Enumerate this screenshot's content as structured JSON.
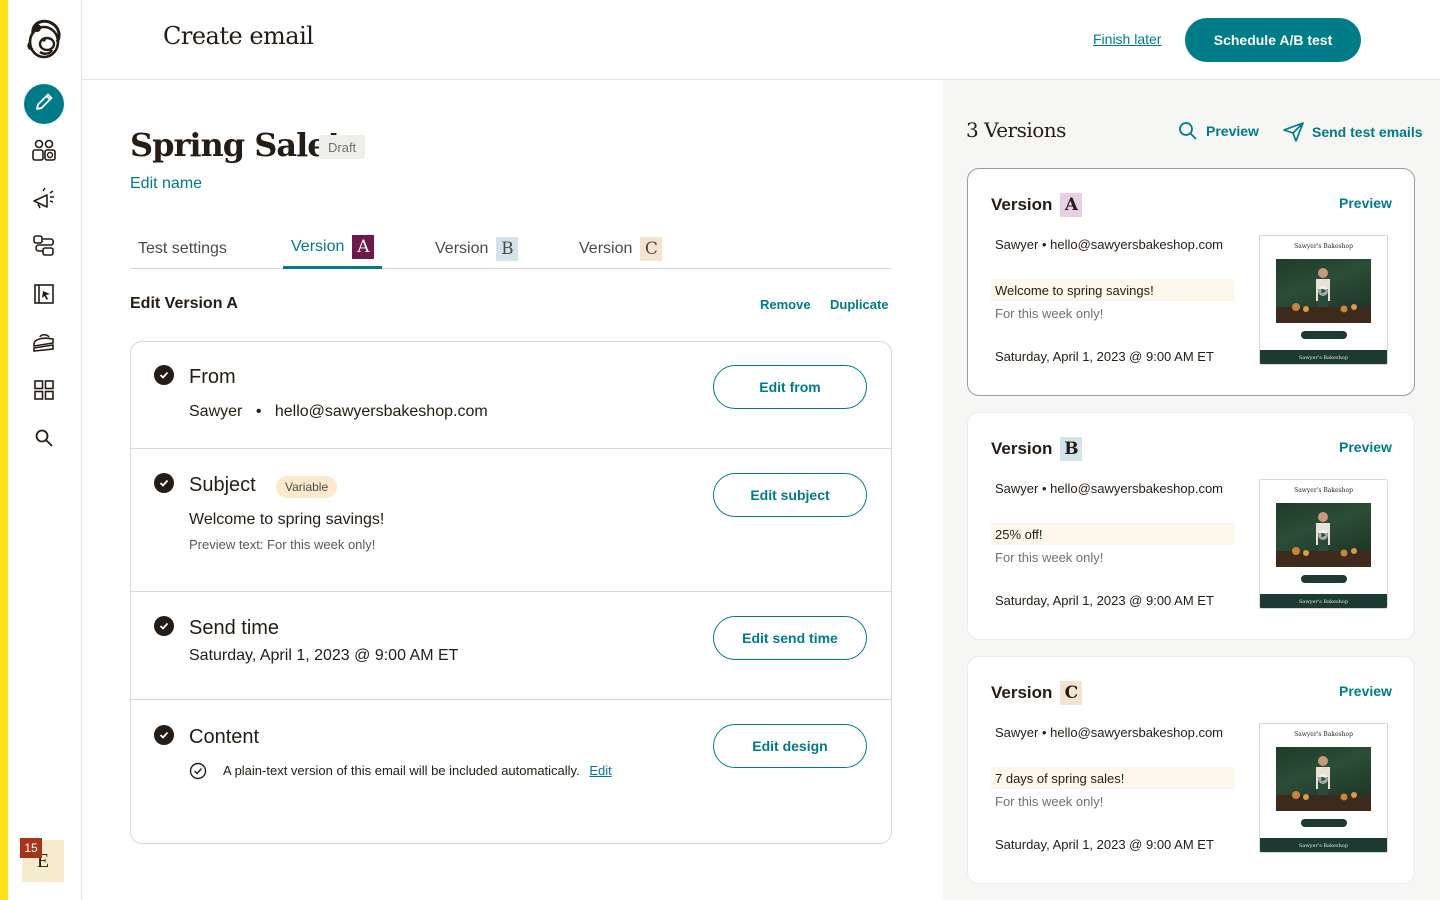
{
  "header": {
    "title": "Create email",
    "finish_later": "Finish later",
    "schedule_button": "Schedule A/B test"
  },
  "sidebar": {
    "items": [
      {
        "name": "create",
        "icon": "pencil-icon",
        "active": true
      },
      {
        "name": "audience",
        "icon": "audience-icon"
      },
      {
        "name": "campaigns",
        "icon": "megaphone-icon"
      },
      {
        "name": "automations",
        "icon": "automation-icon"
      },
      {
        "name": "website",
        "icon": "website-icon"
      },
      {
        "name": "content-studio",
        "icon": "content-icon"
      },
      {
        "name": "integrations",
        "icon": "grid-icon"
      },
      {
        "name": "search",
        "icon": "search-icon"
      }
    ],
    "avatar": {
      "initial": "E",
      "badge": "15"
    }
  },
  "main": {
    "campaign_name": "Spring Sale!",
    "status": "Draft",
    "edit_name": "Edit name",
    "tabs": [
      {
        "label": "Test settings",
        "letter": ""
      },
      {
        "label": "Version",
        "letter": "A"
      },
      {
        "label": "Version",
        "letter": "B"
      },
      {
        "label": "Version",
        "letter": "C"
      }
    ],
    "active_tab": 1,
    "edit_version_title": "Edit Version A",
    "remove": "Remove",
    "duplicate": "Duplicate",
    "sections": {
      "from": {
        "title": "From",
        "name": "Sawyer",
        "separator": "•",
        "email": "hello@sawyersbakeshop.com",
        "button": "Edit from"
      },
      "subject": {
        "title": "Subject",
        "badge": "Variable",
        "subject": "Welcome to spring savings!",
        "preview_text": "Preview text: For this week only!",
        "button": "Edit subject"
      },
      "send_time": {
        "title": "Send time",
        "value": "Saturday, April 1, 2023 @ 9:00 AM ET",
        "button": "Edit send time"
      },
      "content": {
        "title": "Content",
        "note": "A plain-text version of this email will be included automatically.",
        "edit_link": "Edit",
        "button": "Edit design"
      }
    }
  },
  "right_panel": {
    "title": "3 Versions",
    "preview": "Preview",
    "send_test": "Send test emails",
    "versions": [
      {
        "label": "Version",
        "letter": "A",
        "letter_bg": "#e8cfe3",
        "preview": "Preview",
        "from": "Sawyer • hello@sawyersbakeshop.com",
        "subject": "Welcome to spring savings!",
        "preview_text": "For this week only!",
        "date": "Saturday, April 1, 2023 @ 9:00 AM ET",
        "thumb_title": "Sawyer's Bakeshop",
        "thumb_footer": "Sawyer's Bakeshop"
      },
      {
        "label": "Version",
        "letter": "B",
        "letter_bg": "#d4e3ea",
        "preview": "Preview",
        "from": "Sawyer • hello@sawyersbakeshop.com",
        "subject": "25% off!",
        "preview_text": "For this week only!",
        "date": "Saturday, April 1, 2023 @ 9:00 AM ET",
        "thumb_title": "Sawyer's Bakeshop",
        "thumb_footer": "Sawyer's Bakeshop"
      },
      {
        "label": "Version",
        "letter": "C",
        "letter_bg": "#f4e4cf",
        "preview": "Preview",
        "from": "Sawyer • hello@sawyersbakeshop.com",
        "subject": "7 days of spring sales!",
        "preview_text": "For this week only!",
        "date": "Saturday, April 1, 2023 @ 9:00 AM ET",
        "thumb_title": "Sawyer's Bakeshop",
        "thumb_footer": "Sawyer's Bakeshop"
      }
    ]
  },
  "colors": {
    "accent": "#007c89",
    "brand_yellow": "#ffe01b",
    "version_a_letter": "#6b1a4a",
    "text": "#241c15"
  }
}
